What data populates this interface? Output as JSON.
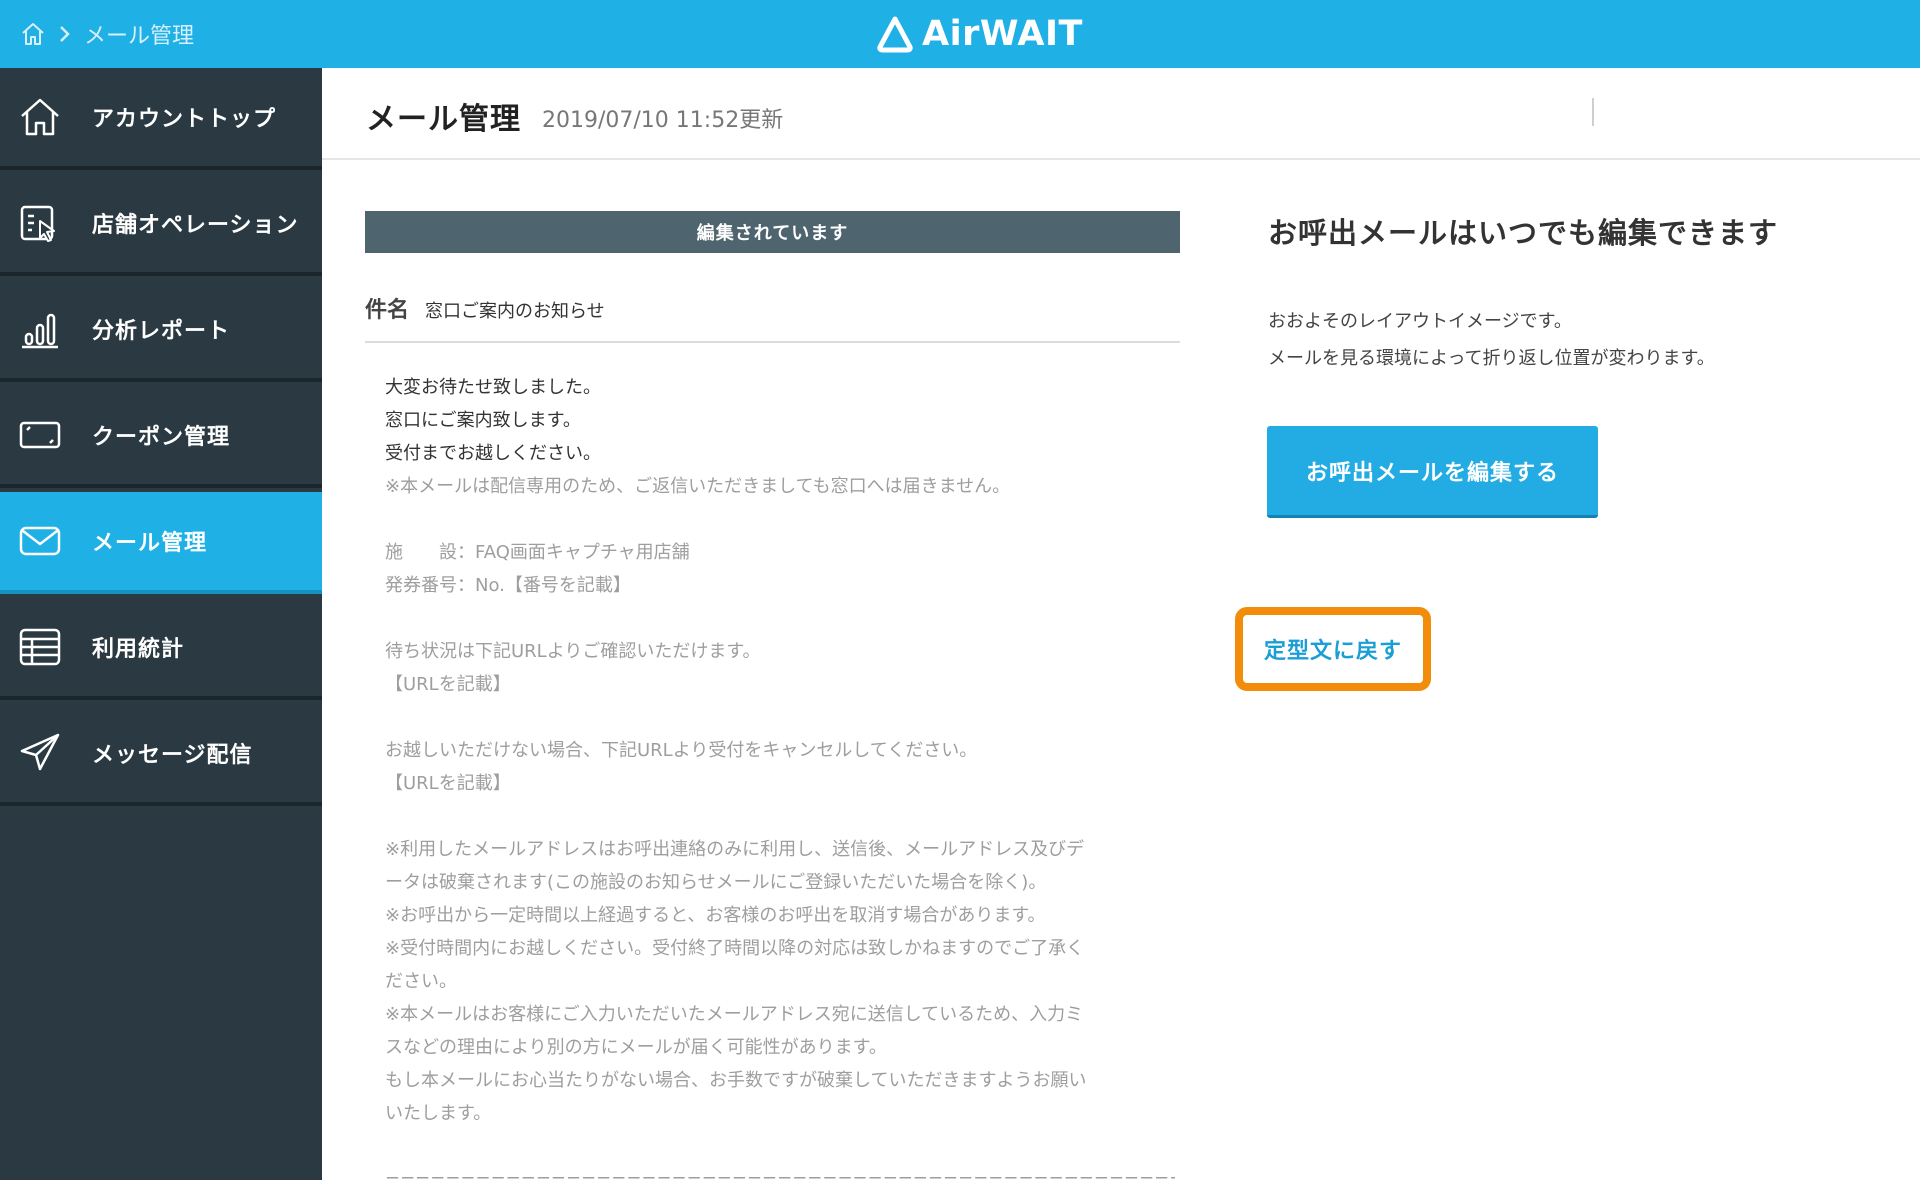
{
  "header": {
    "breadcrumb_current": "メール管理",
    "logo_text": "AirWAIT"
  },
  "sidebar": {
    "items": [
      {
        "label": "アカウントトップ",
        "icon": "home-icon"
      },
      {
        "label": "店舗オペレーション",
        "icon": "clipboard-pointer-icon"
      },
      {
        "label": "分析レポート",
        "icon": "bar-chart-icon"
      },
      {
        "label": "クーポン管理",
        "icon": "coupon-icon"
      },
      {
        "label": "メール管理",
        "icon": "envelope-icon",
        "active": true
      },
      {
        "label": "利用統計",
        "icon": "table-icon"
      },
      {
        "label": "メッセージ配信",
        "icon": "paper-plane-icon"
      }
    ]
  },
  "main": {
    "title": "メール管理",
    "updated": "2019/07/10 11:52更新"
  },
  "preview": {
    "status_banner": "編集されています",
    "subject_key": "件名",
    "subject_value": "窓口ご案内のお知らせ",
    "lines": [
      {
        "text": "大変お待たせ致しました。",
        "style": "dark"
      },
      {
        "text": "窓口にご案内致します。",
        "style": "dark"
      },
      {
        "text": "受付までお越しください。",
        "style": "dark"
      },
      {
        "text": "※本メールは配信専用のため、ご返信いただきましても窓口へは届きません。",
        "style": "grey"
      },
      {
        "text": " ",
        "style": "blank"
      },
      {
        "text": "施　　設：FAQ画面キャプチャ用店舗",
        "style": "grey"
      },
      {
        "text": "発券番号：No.【番号を記載】",
        "style": "grey"
      },
      {
        "text": " ",
        "style": "blank"
      },
      {
        "text": "待ち状況は下記URLよりご確認いただけます。",
        "style": "grey"
      },
      {
        "text": "【URLを記載】",
        "style": "grey"
      },
      {
        "text": " ",
        "style": "blank"
      },
      {
        "text": "お越しいただけない場合、下記URLより受付をキャンセルしてください。",
        "style": "grey"
      },
      {
        "text": "【URLを記載】",
        "style": "grey"
      },
      {
        "text": " ",
        "style": "blank"
      },
      {
        "text": "※利用したメールアドレスはお呼出連絡のみに利用し、送信後、メールアドレス及びデ",
        "style": "grey"
      },
      {
        "text": "ータは破棄されます(この施設のお知らせメールにご登録いただいた場合を除く)。",
        "style": "grey"
      },
      {
        "text": "※お呼出から一定時間以上経過すると、お客様のお呼出を取消す場合があります。",
        "style": "grey"
      },
      {
        "text": "※受付時間内にお越しください。受付終了時間以降の対応は致しかねますのでご了承く",
        "style": "grey"
      },
      {
        "text": "ださい。",
        "style": "grey"
      },
      {
        "text": "※本メールはお客様にご入力いただいたメールアドレス宛に送信しているため、入力ミ",
        "style": "grey"
      },
      {
        "text": "スなどの理由により別の方にメールが届く可能性があります。",
        "style": "grey"
      },
      {
        "text": "もし本メールにお心当たりがない場合、お手数ですが破棄していただきますようお願い",
        "style": "grey"
      },
      {
        "text": "いたします。",
        "style": "grey"
      },
      {
        "text": " ",
        "style": "blank"
      },
      {
        "text": "========================================================",
        "style": "grey"
      }
    ]
  },
  "side_panel": {
    "title": "お呼出メールはいつでも編集できます",
    "desc_lines": [
      "おおよそのレイアウトイメージです。",
      "メールを見る環境によって折り返し位置が変わります。"
    ],
    "edit_button": "お呼出メールを編集する",
    "reset_link": "定型文に戻す",
    "highlight_color": "#f28d0b"
  },
  "colors": {
    "brand": "#1fb0e6",
    "sidebar_bg": "#2b3a42",
    "banner_bg": "#4e646e"
  }
}
